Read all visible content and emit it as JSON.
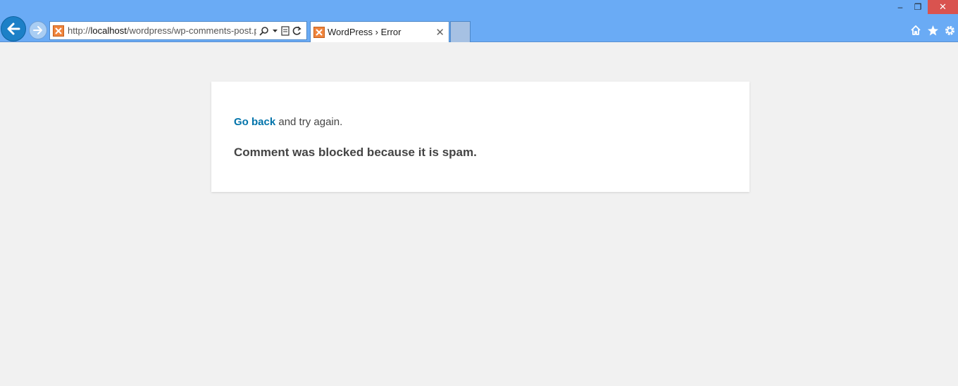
{
  "window": {
    "minimize_glyph": "‒",
    "restore_glyph": "❐",
    "close_glyph": "✕"
  },
  "address_bar": {
    "url_prefix": "http://",
    "url_host": "localhost",
    "url_path": "/wordpress/wp-comments-post.ph"
  },
  "tab": {
    "title": "WordPress › Error",
    "close_glyph": "✕"
  },
  "error_page": {
    "go_back_link": "Go back",
    "go_back_suffix": " and try again.",
    "message": "Comment was blocked because it is spam."
  },
  "colors": {
    "chrome_bg": "#6aabf5",
    "close_btn_bg": "#d9534f",
    "page_bg": "#f1f1f1",
    "link": "#0073aa",
    "text": "#444444"
  }
}
